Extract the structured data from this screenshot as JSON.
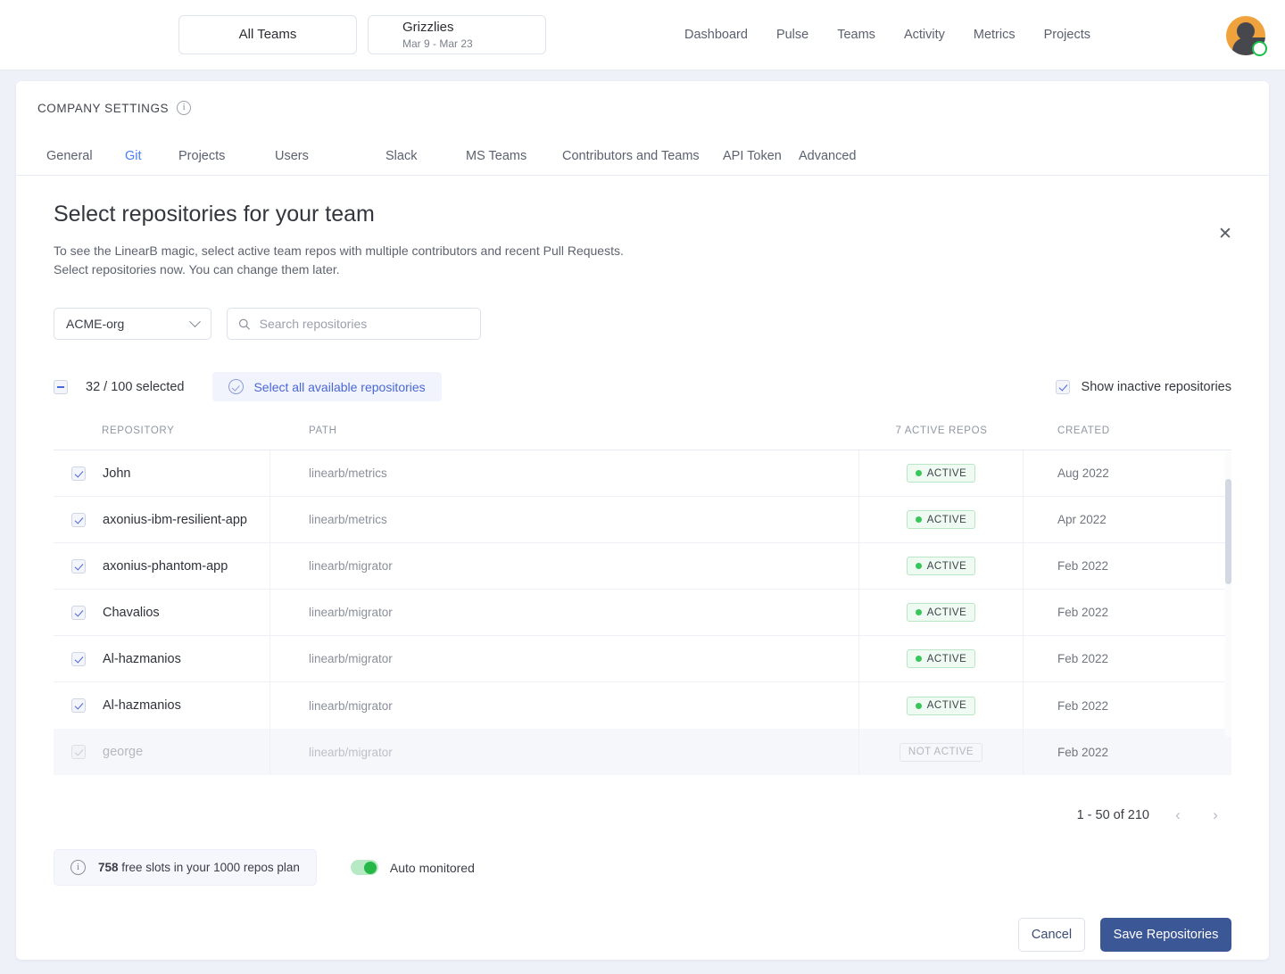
{
  "topnav": {
    "team_all": "All Teams",
    "team_current": "Grizzlies",
    "team_range": "Mar 9 - Mar 23",
    "links": [
      "Dashboard",
      "Pulse",
      "Teams",
      "Activity",
      "Metrics",
      "Projects"
    ],
    "avatar_icon": "user-avatar",
    "avatar_badge_icon": "github-badge-icon"
  },
  "settings": {
    "heading": "COMPANY SETTINGS",
    "info_icon": "info-icon",
    "tabs": [
      {
        "label": "General",
        "active": false
      },
      {
        "label": "Git",
        "active": true
      },
      {
        "label": "Projects",
        "active": false
      },
      {
        "label": "Users",
        "active": false
      },
      {
        "label": "Slack",
        "active": false
      },
      {
        "label": "MS Teams",
        "active": false
      },
      {
        "label": "Contributors and Teams",
        "active": false
      },
      {
        "label": "API Token",
        "active": false
      },
      {
        "label": "Advanced",
        "active": false
      }
    ]
  },
  "dialog": {
    "title": "Select repositories for your team",
    "close_icon": "close-icon",
    "subtitle_line1": "To see the LinearB magic, select active team repos with multiple contributors and recent Pull Requests.",
    "subtitle_line2": "Select repositories now. You can change them later."
  },
  "controls": {
    "org_value": "ACME-org",
    "org_chevron_icon": "chevron-down-icon",
    "search_placeholder": "Search repositories",
    "search_value": "",
    "search_icon": "search-icon",
    "selected_count": "32 / 100 selected",
    "select_all_label": "Select all available repositories",
    "select_all_icon": "check-circle-icon",
    "show_inactive_label": "Show inactive repositories",
    "show_inactive_checked": true
  },
  "table": {
    "columns": [
      "REPOSITORY",
      "PATH",
      "7 ACTIVE REPOS",
      "CREATED"
    ],
    "rows": [
      {
        "name": "John",
        "path": "linearb/metrics",
        "status": "ACTIVE",
        "active": true,
        "created": "Aug 2022",
        "checked": true,
        "disabled": false
      },
      {
        "name": "axonius-ibm-resilient-app",
        "path": "linearb/metrics",
        "status": "ACTIVE",
        "active": true,
        "created": "Apr 2022",
        "checked": true,
        "disabled": false
      },
      {
        "name": "axonius-phantom-app",
        "path": "linearb/migrator",
        "status": "ACTIVE",
        "active": true,
        "created": "Feb 2022",
        "checked": true,
        "disabled": false
      },
      {
        "name": "Chavalios",
        "path": "linearb/migrator",
        "status": "ACTIVE",
        "active": true,
        "created": "Feb 2022",
        "checked": true,
        "disabled": false
      },
      {
        "name": "Al-hazmanios",
        "path": "linearb/migrator",
        "status": "ACTIVE",
        "active": true,
        "created": "Feb 2022",
        "checked": true,
        "disabled": false
      },
      {
        "name": "Al-hazmanios",
        "path": "linearb/migrator",
        "status": "ACTIVE",
        "active": true,
        "created": "Feb 2022",
        "checked": true,
        "disabled": false
      },
      {
        "name": "george",
        "path": "linearb/migrator",
        "status": "NOT ACTIVE",
        "active": false,
        "created": "Feb 2022",
        "checked": true,
        "disabled": true
      }
    ]
  },
  "pagination": {
    "info": "1 - 50 of 210",
    "prev_icon": "chevron-left-icon",
    "next_icon": "chevron-right-icon",
    "prev_glyph": "‹",
    "next_glyph": "›"
  },
  "footer": {
    "slots_count": "758",
    "slots_text": " free slots in your 1000 repos plan",
    "slots_icon": "info-icon",
    "auto_monitored_label": "Auto monitored",
    "auto_monitored_on": true,
    "cancel_label": "Cancel",
    "save_label": "Save Repositories"
  },
  "colors": {
    "accent_blue": "#4a67d6",
    "link_blue": "#4a7cf7",
    "save_button": "#3c5795",
    "active_green": "#35c75a",
    "page_bg": "#eef1f8"
  }
}
